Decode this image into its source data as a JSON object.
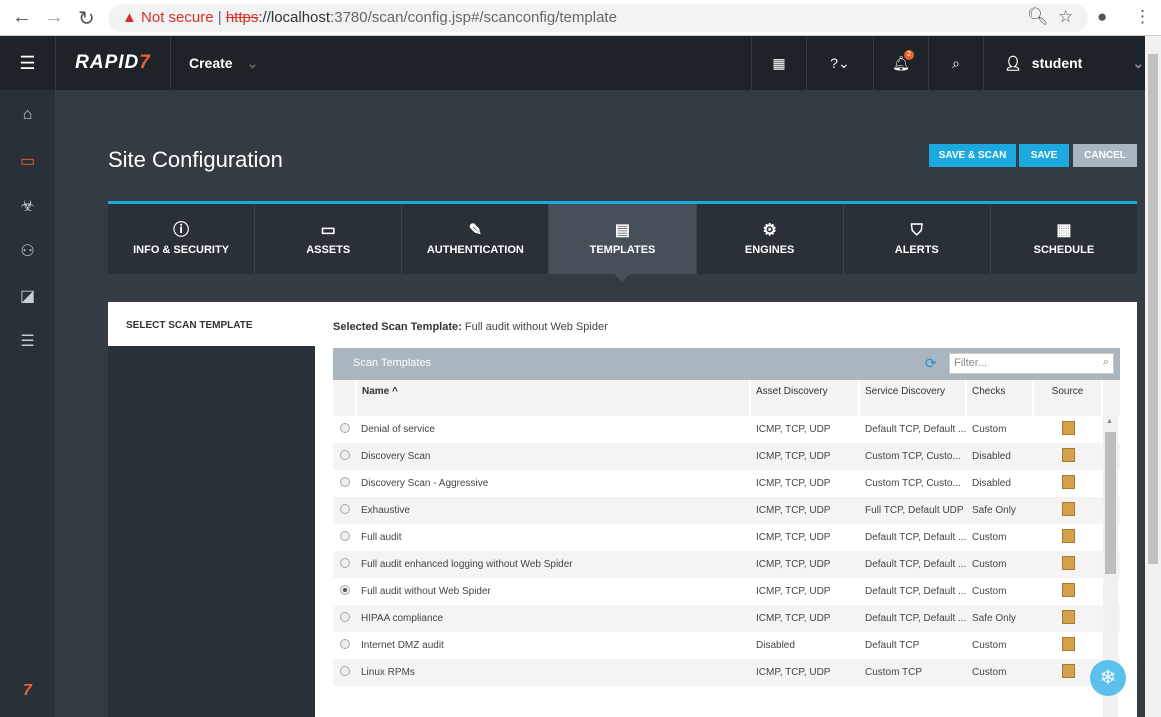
{
  "browser": {
    "not_secure": "Not secure",
    "url_scheme": "https",
    "url_host": "://localhost",
    "url_rest": ":3780/scan/config.jsp#/scanconfig/template"
  },
  "header": {
    "logo": "RAPID",
    "logo_mark": "7",
    "create": "Create",
    "user": "student",
    "notifications": "2"
  },
  "page": {
    "title": "Site Configuration",
    "save_scan": "SAVE & SCAN",
    "save": "SAVE",
    "cancel": "CANCEL"
  },
  "tabs": [
    {
      "label": "INFO & SECURITY",
      "icon": "ⓘ"
    },
    {
      "label": "ASSETS",
      "icon": "▭"
    },
    {
      "label": "AUTHENTICATION",
      "icon": "✎"
    },
    {
      "label": "TEMPLATES",
      "icon": "▤"
    },
    {
      "label": "ENGINES",
      "icon": "⚙"
    },
    {
      "label": "ALERTS",
      "icon": "⛉"
    },
    {
      "label": "SCHEDULE",
      "icon": "▦"
    }
  ],
  "left": {
    "label": "SELECT SCAN TEMPLATE"
  },
  "selected": {
    "label": "Selected Scan Template:",
    "value": "Full audit without Web Spider"
  },
  "table": {
    "title": "Scan Templates",
    "filter_placeholder": "Filter...",
    "columns": [
      "Name ^",
      "Asset Discovery",
      "Service Discovery",
      "Checks",
      "Source"
    ],
    "rows": [
      [
        "Denial of service",
        "ICMP, TCP, UDP",
        "Default TCP, Default ...",
        "Custom"
      ],
      [
        "Discovery Scan",
        "ICMP, TCP, UDP",
        "Custom TCP, Custo...",
        "Disabled"
      ],
      [
        "Discovery Scan - Aggressive",
        "ICMP, TCP, UDP",
        "Custom TCP, Custo...",
        "Disabled"
      ],
      [
        "Exhaustive",
        "ICMP, TCP, UDP",
        "Full TCP, Default UDP",
        "Safe Only"
      ],
      [
        "Full audit",
        "ICMP, TCP, UDP",
        "Default TCP, Default ...",
        "Custom"
      ],
      [
        "Full audit enhanced logging without Web Spider",
        "ICMP, TCP, UDP",
        "Default TCP, Default ...",
        "Custom"
      ],
      [
        "Full audit without Web Spider",
        "ICMP, TCP, UDP",
        "Default TCP, Default ...",
        "Custom"
      ],
      [
        "HIPAA compliance",
        "ICMP, TCP, UDP",
        "Default TCP, Default ...",
        "Safe Only"
      ],
      [
        "Internet DMZ audit",
        "Disabled",
        "Default TCP",
        "Custom"
      ],
      [
        "Linux RPMs",
        "ICMP, TCP, UDP",
        "Custom TCP",
        "Custom"
      ]
    ],
    "selected_index": 6
  }
}
